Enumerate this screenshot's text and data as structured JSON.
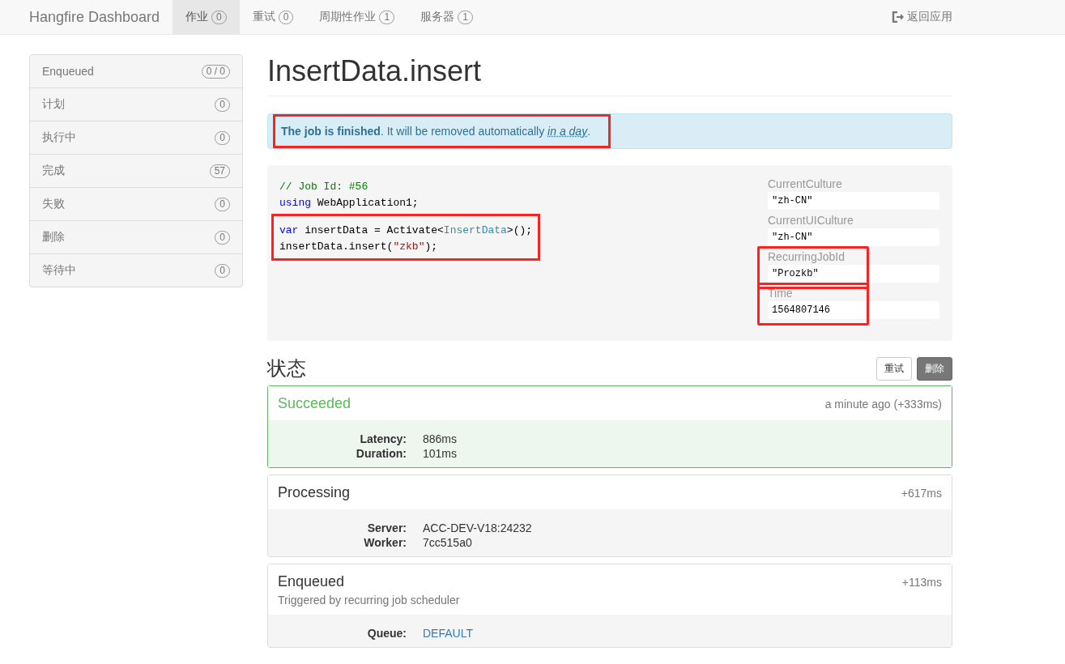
{
  "navbar": {
    "brand": "Hangfire Dashboard",
    "tabs": [
      {
        "label": "作业",
        "count": "0",
        "selected": true
      },
      {
        "label": "重试",
        "count": "0",
        "selected": false
      },
      {
        "label": "周期性作业",
        "count": "1",
        "selected": false
      },
      {
        "label": "服务器",
        "count": "1",
        "selected": false
      }
    ],
    "back_link": "返回应用"
  },
  "sidebar": {
    "items": [
      {
        "label": "Enqueued",
        "count": "0 / 0",
        "selected": false
      },
      {
        "label": "计划",
        "count": "0",
        "selected": false
      },
      {
        "label": "执行中",
        "count": "0",
        "selected": false
      },
      {
        "label": "完成",
        "count": "57",
        "selected": false
      },
      {
        "label": "失败",
        "count": "0",
        "selected": false
      },
      {
        "label": "删除",
        "count": "0",
        "selected": false
      },
      {
        "label": "等待中",
        "count": "0",
        "selected": false
      }
    ]
  },
  "job": {
    "title": "InsertData.insert",
    "alert": {
      "message": "**The job is finished**. It will be removed automatically ",
      "link": "in a day",
      "after": ".",
      "highlighted": true
    },
    "code": {
      "blocks": [
        {
          "highlighted": false,
          "lines": [
            [
              {
                "kind": "comment",
                "text": "// Job Id: #56"
              }
            ],
            [
              {
                "kind": "keyword",
                "text": "using"
              },
              {
                "kind": "plain",
                "text": " WebApplication1;"
              }
            ]
          ]
        },
        {
          "highlighted": true,
          "lines": [
            [
              {
                "kind": "keyword",
                "text": "var"
              },
              {
                "kind": "plain",
                "text": " insertData = Activate<"
              },
              {
                "kind": "type",
                "text": "InsertData"
              },
              {
                "kind": "plain",
                "text": ">();"
              }
            ],
            [
              {
                "kind": "plain",
                "text": "insertData.insert("
              },
              {
                "kind": "string",
                "text": "\"zkb\""
              },
              {
                "kind": "plain",
                "text": ");"
              }
            ]
          ]
        }
      ]
    },
    "parameters": [
      {
        "name": "CurrentCulture",
        "value": "\"zh-CN\"",
        "highlighted": false
      },
      {
        "name": "CurrentUICulture",
        "value": "\"zh-CN\"",
        "highlighted": false
      },
      {
        "name": "RecurringJobId",
        "value": "\"Prozkb\"",
        "highlighted": true
      },
      {
        "name": "Time",
        "value": "1564807146",
        "highlighted": true
      }
    ]
  },
  "states": {
    "heading": "状态",
    "buttons": [
      {
        "label": "重试",
        "kind": "default"
      },
      {
        "label": "删除",
        "kind": "dark"
      }
    ],
    "cards": [
      {
        "kind": "succeeded",
        "title": "Succeeded",
        "time": "a minute ago (+333ms)",
        "fields": [
          {
            "label": "Latency:",
            "value": "886ms",
            "kind": "text"
          },
          {
            "label": "Duration:",
            "value": "101ms",
            "kind": "text"
          }
        ]
      },
      {
        "kind": "processing",
        "title": "Processing",
        "time": "+617ms",
        "fields": [
          {
            "label": "Server:",
            "value": "ACC-DEV-V18:24232",
            "kind": "text"
          },
          {
            "label": "Worker:",
            "value": "7cc515a0",
            "kind": "text"
          }
        ]
      },
      {
        "kind": "enqueued",
        "title": "Enqueued",
        "time": "+113ms",
        "description": "Triggered by recurring job scheduler",
        "fields": [
          {
            "label": "Queue:",
            "value": "DEFAULT",
            "kind": "link"
          }
        ]
      }
    ]
  }
}
